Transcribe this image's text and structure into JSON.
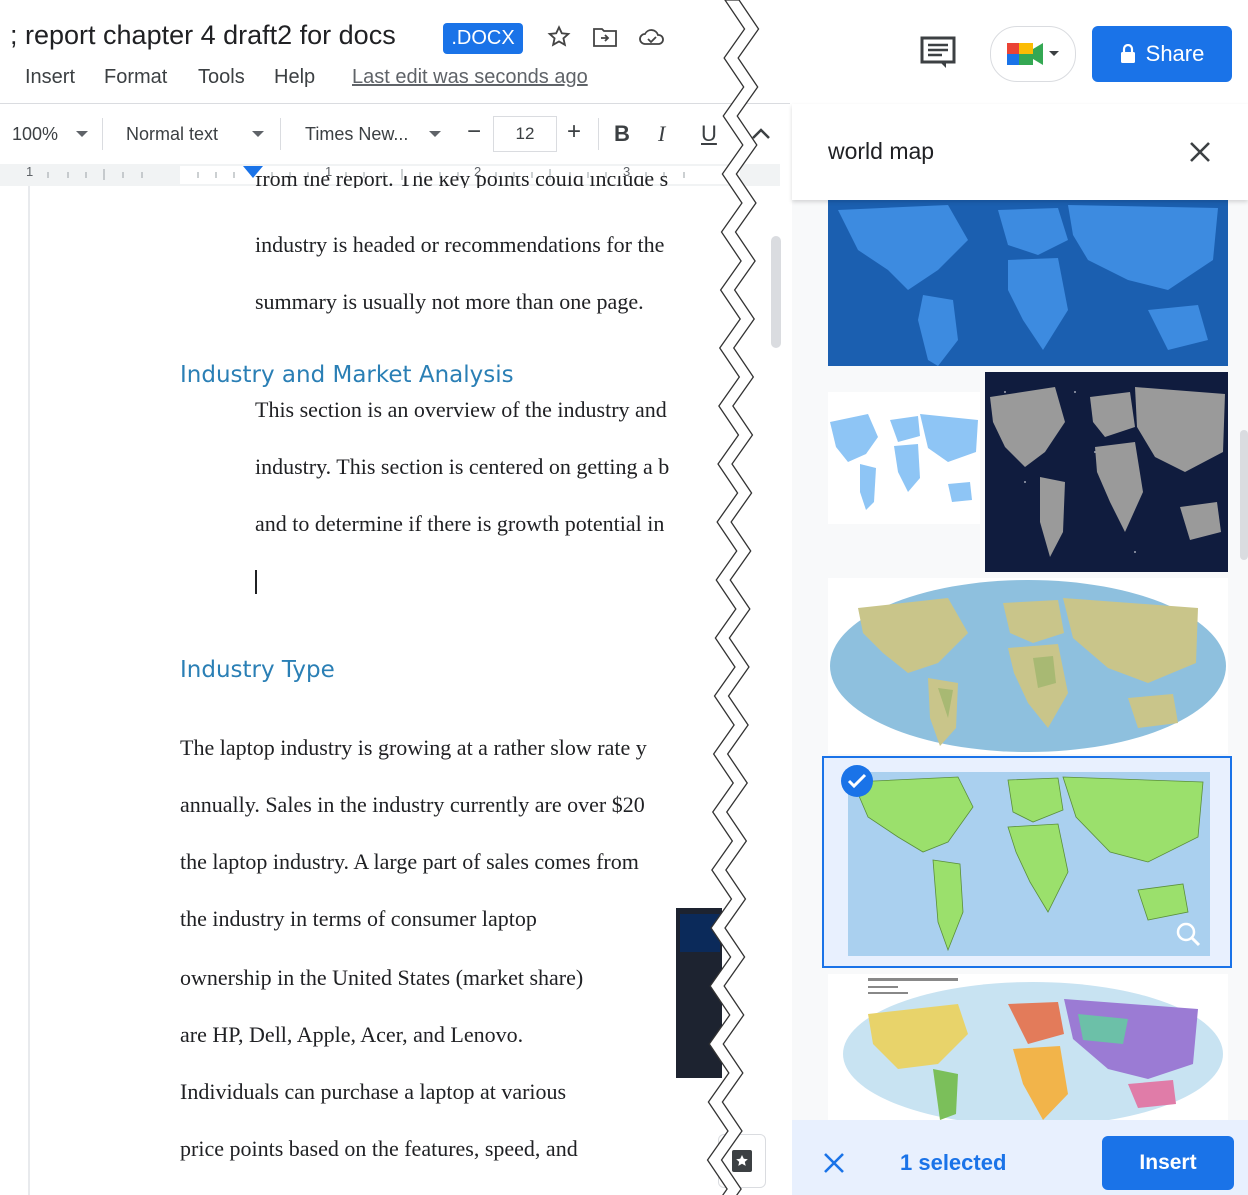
{
  "header": {
    "title": "; report chapter 4 draft2 for docs",
    "badge": ".DOCX",
    "share_label": "Share",
    "menu": [
      "Insert",
      "Format",
      "Tools",
      "Help"
    ],
    "last_edit": "Last edit was seconds ago"
  },
  "toolbar": {
    "zoom": "100%",
    "style": "Normal text",
    "font": "Times New...",
    "minus": "−",
    "font_size": "12",
    "plus": "+",
    "bold": "B",
    "italic": "I",
    "underline": "U"
  },
  "ruler": {
    "numbers": [
      "1",
      "1",
      "2",
      "3"
    ]
  },
  "document": {
    "partial_top_line": "from the report.  The key points could include s",
    "para1": [
      "industry is headed or recommendations for the",
      "summary is usually not more than one page."
    ],
    "heading1": "Industry and Market Analysis",
    "para2": [
      "This section is an overview of the industry and",
      "industry.  This section is centered on getting a b",
      "and to determine if there is growth potential in"
    ],
    "heading2": "Industry Type",
    "para3": [
      "The laptop industry is growing at a rather slow rate y",
      "annually.  Sales in the industry currently are over $20",
      "the laptop industry.  A large part of sales comes from",
      "the industry in terms of consumer laptop",
      "ownership in the United States (market share)",
      "are HP, Dell, Apple, Acer, and Lenovo.",
      "Individuals can purchase a laptop at various",
      "price points based on the features, speed, and"
    ]
  },
  "panel": {
    "search_query": "world map",
    "selected_count": "1 selected",
    "insert_label": "Insert",
    "images": [
      "blue world map",
      "light blue world map",
      "world map on starry background",
      "physical world map",
      "green political world map (selected)",
      "colorful political world map"
    ]
  },
  "colors": {
    "accent": "#1a73e8",
    "heading": "#2a7fb5",
    "selected_bg": "#e8f0fe"
  },
  "icons": [
    "star-icon",
    "move-to-folder-icon",
    "cloud-status-icon",
    "comment-icon",
    "meet-icon",
    "lock-icon",
    "close-icon",
    "check-icon",
    "zoom-icon",
    "explore-icon"
  ]
}
